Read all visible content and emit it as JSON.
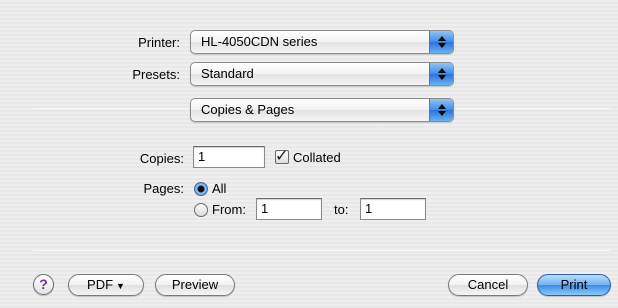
{
  "printer": {
    "label": "Printer:",
    "value": "HL-4050CDN series",
    "icon": "popup-arrows-icon"
  },
  "presets": {
    "label": "Presets:",
    "value": "Standard",
    "icon": "popup-arrows-icon"
  },
  "panel": {
    "value": "Copies & Pages",
    "icon": "popup-arrows-icon"
  },
  "copies": {
    "label": "Copies:",
    "value": "1",
    "collated_label": "Collated",
    "collated_checked": true
  },
  "pages": {
    "label": "Pages:",
    "all_label": "All",
    "all_selected": true,
    "from_label": "From:",
    "from_value": "1",
    "to_label": "to:",
    "to_value": "1"
  },
  "footer": {
    "help_symbol": "?",
    "pdf_label": "PDF",
    "pdf_caret": "▼",
    "preview_label": "Preview",
    "cancel_label": "Cancel",
    "print_label": "Print"
  },
  "colors": {
    "accent": "#3c8ce6",
    "background": "#ececec"
  }
}
